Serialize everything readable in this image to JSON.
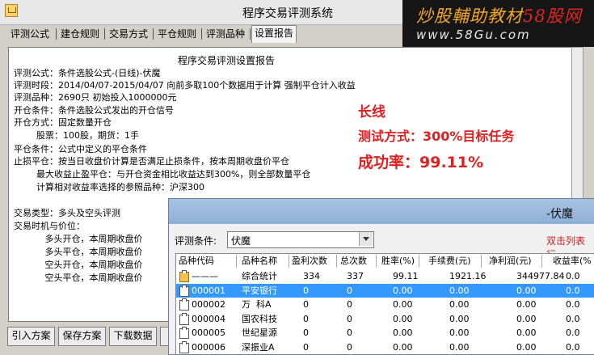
{
  "window": {
    "title": "程序交易评测系统"
  },
  "watermark": {
    "line1_a": "炒股輔助教材",
    "line1_b": "58股网",
    "line2": "www.58Gu.com"
  },
  "tabs": [
    "评测公式",
    "建仓规则",
    "交易方式",
    "平仓规则",
    "评测品种",
    "设置报告"
  ],
  "active_tab": "设置报告",
  "report": {
    "heading": "程序交易评测设置报告",
    "lines": [
      "评测公式：条件选股公式-(日线)-伏魔",
      "评测时段：2014/04/07-2015/04/07 向前多取100个数据用于计算 强制平仓计入收益",
      "评测品种：2690只 初始投入1000000元",
      "开仓条件：条件选股公式发出的开仓信号",
      "开仓方式：固定数量开仓",
      "        股票：100股，期货：1手",
      "平仓条件：公式中定义的平仓条件",
      "止损平仓：按当日收盘价计算是否满足止损条件，按本周期收盘价平仓",
      "        最大收益止盈平仓：与开仓资金相比收益达到300%，则全部数量平仓",
      "        计算相对收益率选择的参照品种：沪深300",
      "",
      "交易类型：多头及空头评测",
      "交易时机与价位：",
      "           多头开仓，本周期收盘价",
      "           多头平仓，本周期收盘价",
      "           空头开仓，本周期收盘价",
      "           空头平仓，本周期收盘价"
    ]
  },
  "annotations": {
    "line1": "长线",
    "line2": "测试方式：300%目标任务",
    "line3": "成功率：99.11%"
  },
  "buttons": [
    "引入方案",
    "保存方案",
    "下载数据"
  ],
  "result_window": {
    "title": "-伏魔",
    "filter_label": "评测条件:",
    "filter_value": "伏魔",
    "hint": "双击列表行",
    "columns": [
      "品种代码",
      "品种名称",
      "盈利次数",
      "总次数",
      "胜率(%)",
      "手续费(元)",
      "净利润(元)",
      "收益率(%"
    ],
    "rows": [
      [
        "———",
        "综合统计",
        "334",
        "337",
        "99.11",
        "1921.16",
        "344977.84",
        "0.0"
      ],
      [
        "000001",
        "平安银行",
        "0",
        "0",
        "0.00",
        "0.00",
        "0.00",
        "0.0"
      ],
      [
        "000002",
        "万  科A",
        "0",
        "0",
        "0.00",
        "0.00",
        "0.00",
        "0.0"
      ],
      [
        "000004",
        "国农科技",
        "0",
        "0",
        "0.00",
        "0.00",
        "0.00",
        "0.0"
      ],
      [
        "000005",
        "世纪星源",
        "0",
        "0",
        "0.00",
        "0.00",
        "0.00",
        "0.0"
      ],
      [
        "000006",
        "深振业A",
        "0",
        "0",
        "0.00",
        "0.00",
        "0.00",
        "0.0"
      ]
    ],
    "selected_row": 1,
    "colors": {
      "selected": "#3399ff",
      "title_bar": "#9ab7df",
      "annotation": "#e02020"
    }
  }
}
